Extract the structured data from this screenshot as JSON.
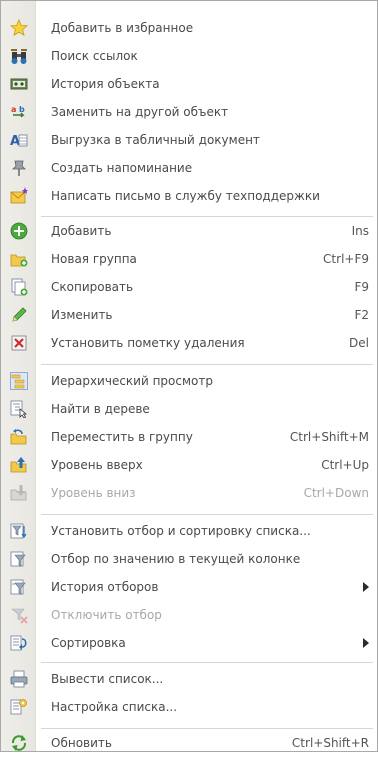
{
  "menu": {
    "items": [
      {
        "label": "Добавить в избранное",
        "shortcut": "",
        "icon": "star-icon"
      },
      {
        "label": "Поиск ссылок",
        "shortcut": "",
        "icon": "binoculars-icon"
      },
      {
        "label": "История объекта",
        "shortcut": "",
        "icon": "history-icon"
      },
      {
        "label": "Заменить на другой объект",
        "shortcut": "",
        "icon": "replace-icon"
      },
      {
        "label": "Выгрузка в табличный документ",
        "shortcut": "",
        "icon": "export-table-icon"
      },
      {
        "label": "Создать напоминание",
        "shortcut": "",
        "icon": "pin-icon"
      },
      {
        "label": "Написать письмо в службу техподдержки",
        "shortcut": "",
        "icon": "mail-icon"
      },
      {
        "label": "Добавить",
        "shortcut": "Ins",
        "icon": "add-icon"
      },
      {
        "label": "Новая группа",
        "shortcut": "Ctrl+F9",
        "icon": "new-folder-icon"
      },
      {
        "label": "Скопировать",
        "shortcut": "F9",
        "icon": "copy-icon"
      },
      {
        "label": "Изменить",
        "shortcut": "F2",
        "icon": "pencil-icon"
      },
      {
        "label": "Установить пометку удаления",
        "shortcut": "Del",
        "icon": "delete-mark-icon"
      },
      {
        "label": "Иерархический просмотр",
        "shortcut": "",
        "icon": "hierarchy-icon"
      },
      {
        "label": "Найти в дереве",
        "shortcut": "",
        "icon": "find-in-tree-icon"
      },
      {
        "label": "Переместить в группу",
        "shortcut": "Ctrl+Shift+M",
        "icon": "move-to-group-icon"
      },
      {
        "label": "Уровень вверх",
        "shortcut": "Ctrl+Up",
        "icon": "level-up-icon"
      },
      {
        "label": "Уровень вниз",
        "shortcut": "Ctrl+Down",
        "icon": "level-down-icon"
      },
      {
        "label": "Установить отбор и сортировку списка...",
        "shortcut": "",
        "icon": "filter-sort-icon"
      },
      {
        "label": "Отбор по значению в текущей колонке",
        "shortcut": "",
        "icon": "filter-by-value-icon"
      },
      {
        "label": "История отборов",
        "shortcut": "",
        "icon": "filter-history-icon"
      },
      {
        "label": "Отключить отбор",
        "shortcut": "",
        "icon": "filter-off-icon"
      },
      {
        "label": "Сортировка",
        "shortcut": "",
        "icon": "sort-icon"
      },
      {
        "label": "Вывести список...",
        "shortcut": "",
        "icon": "print-list-icon"
      },
      {
        "label": "Настройка списка...",
        "shortcut": "",
        "icon": "list-settings-icon"
      },
      {
        "label": "Обновить",
        "shortcut": "Ctrl+Shift+R",
        "icon": "refresh-icon"
      }
    ]
  }
}
